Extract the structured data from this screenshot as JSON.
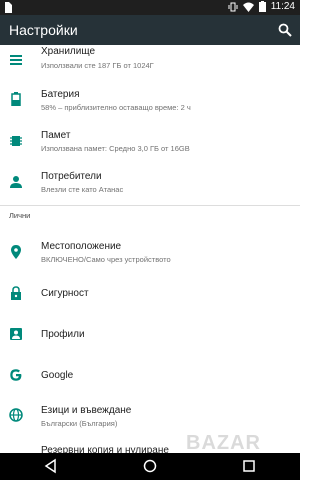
{
  "status": {
    "time": "11:24"
  },
  "app_bar": {
    "title": "Настройки"
  },
  "items": [
    {
      "title": "Хранилище",
      "subtitle": "Използвали сте 187 ГБ от 1024Г"
    },
    {
      "title": "Батерия",
      "subtitle": "58% – приблизително оставащо време: 2 ч"
    },
    {
      "title": "Памет",
      "subtitle": "Използвана памет: Средно 3,0 ГБ от 16GB"
    },
    {
      "title": "Потребители",
      "subtitle": "Влезли сте като Атанас"
    }
  ],
  "section": {
    "label": "Лични"
  },
  "personal_items": [
    {
      "title": "Местоположение",
      "subtitle": "ВКЛЮЧЕНО/Само чрез устройството"
    },
    {
      "title": "Сигурност"
    },
    {
      "title": "Профили"
    },
    {
      "title": "Google"
    },
    {
      "title": "Езици и въвеждане",
      "subtitle": "Български (България)"
    },
    {
      "title": "Резервни копия и нулиране"
    }
  ],
  "watermark": "BAZAR",
  "colors": {
    "accent": "#00897b",
    "app_bar": "#263238",
    "status_bar": "#1f1f1f",
    "nav_bar": "#000000"
  }
}
